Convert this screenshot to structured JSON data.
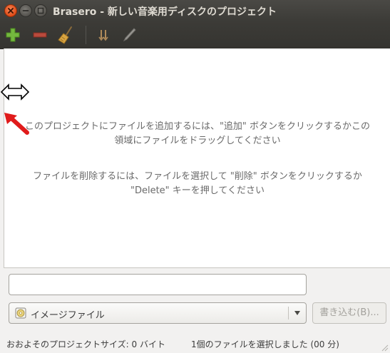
{
  "window": {
    "title": "Brasero - 新しい音楽用ディスクのプロジェクト"
  },
  "toolbar": {
    "items": [
      {
        "icon": "add-icon",
        "color": "#74b83e"
      },
      {
        "icon": "remove-icon",
        "color": "#b94a3c"
      },
      {
        "icon": "broom-icon",
        "color": "#d9a441"
      },
      {
        "icon": "split-icon",
        "color": "#9a9893"
      },
      {
        "icon": "pen-icon",
        "color": "#9a9893"
      }
    ]
  },
  "project_area": {
    "hint_add_line1": "このプロジェクトにファイルを追加するには、\"追加\" ボタンをクリックするかこの",
    "hint_add_line2": "領域にファイルをドラッグしてください",
    "hint_remove_line1": "ファイルを削除するには、ファイルを選択して \"削除\" ボタンをクリックするか",
    "hint_remove_line2": "\"Delete\" キーを押してください"
  },
  "name_field": {
    "value": ""
  },
  "disc_selector": {
    "selected": "イメージファイル",
    "icon": "disc-image-icon"
  },
  "burn_button": {
    "label": "書き込む(B)..."
  },
  "status": {
    "project_size": "おおよそのプロジェクトサイズ: 0 バイト",
    "selection": "1個のファイルを選択しました (00 分)"
  },
  "cursors": {
    "resize": "resize-horizontal-icon",
    "pointer": "red-arrow-icon",
    "pointer_color": "#e01b1b"
  }
}
